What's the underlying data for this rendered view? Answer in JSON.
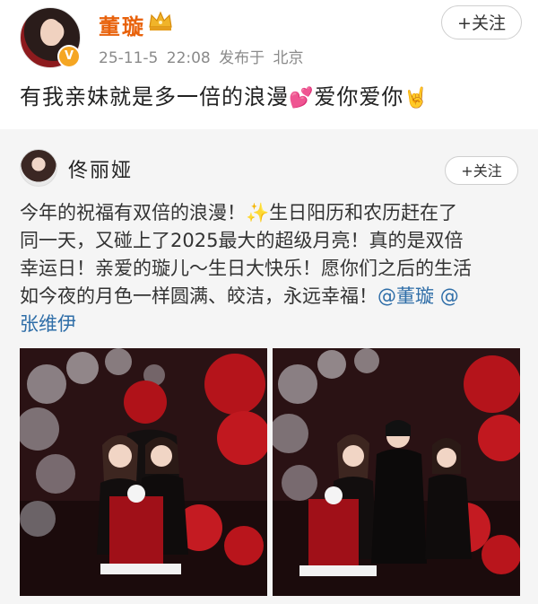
{
  "post": {
    "author": "董璇",
    "timestamp": "25-11-5 22:08",
    "location_label": "发布于 北京",
    "follow_label": "+关注",
    "text": "有我亲妹就是多一倍的浪漫",
    "emoji_1": "💕",
    "text_2": "爱你爱你",
    "emoji_2": "🤘"
  },
  "repost": {
    "author": "佟丽娅",
    "follow_label": "+关注",
    "lines": [
      "今年的祝福有双倍的浪漫！",
      "同一天，又碰上了2025最大的超级月亮！真的是双倍",
      "幸运日！亲爱的璇儿～生日大快乐！愿你们之后的生活",
      "如今夜的月色一样圆满、皎洁，永远幸福！"
    ],
    "line1_tail": "生日阳历和农历赶在了",
    "sparkle": "✨",
    "mention_1": "@董璇",
    "mention_2": "@",
    "mention_2_cont": "张维伊"
  },
  "icons": {
    "verify": "verified-badge-icon",
    "crown": "crown-icon",
    "sparkle": "sparkle-icon"
  },
  "colors": {
    "author_name": "#e8620c",
    "mention": "#2f6ea8",
    "repost_bg": "#f5f5f5"
  }
}
